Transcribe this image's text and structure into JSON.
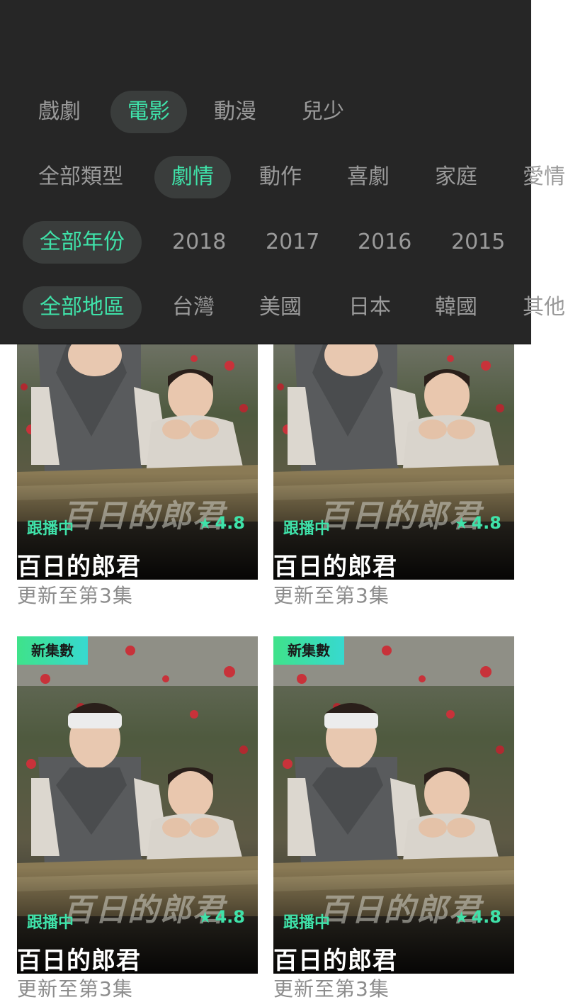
{
  "filters": {
    "categories": [
      {
        "label": "戲劇",
        "active": false
      },
      {
        "label": "電影",
        "active": true
      },
      {
        "label": "動漫",
        "active": false
      },
      {
        "label": "兒少",
        "active": false
      }
    ],
    "genres": [
      {
        "label": "全部類型",
        "active": false
      },
      {
        "label": "劇情",
        "active": true
      },
      {
        "label": "動作",
        "active": false
      },
      {
        "label": "喜劇",
        "active": false
      },
      {
        "label": "家庭",
        "active": false
      },
      {
        "label": "愛情",
        "active": false
      }
    ],
    "years": [
      {
        "label": "全部年份",
        "active": true
      },
      {
        "label": "2018",
        "active": false
      },
      {
        "label": "2017",
        "active": false
      },
      {
        "label": "2016",
        "active": false
      },
      {
        "label": "2015",
        "active": false
      }
    ],
    "regions": [
      {
        "label": "全部地區",
        "active": true
      },
      {
        "label": "台灣",
        "active": false
      },
      {
        "label": "美國",
        "active": false
      },
      {
        "label": "日本",
        "active": false
      },
      {
        "label": "韓國",
        "active": false
      },
      {
        "label": "其他",
        "active": false
      }
    ]
  },
  "cards": [
    {
      "title": "百日的郎君",
      "status": "跟播中",
      "rating": "4.8",
      "subtitle": "更新至第3集",
      "poster_text": "百日的郎君",
      "badge": ""
    },
    {
      "title": "百日的郎君",
      "status": "跟播中",
      "rating": "4.8",
      "subtitle": "更新至第3集",
      "poster_text": "百日的郎君",
      "badge": ""
    },
    {
      "title": "百日的郎君",
      "status": "跟播中",
      "rating": "4.8",
      "subtitle": "更新至第3集",
      "poster_text": "百日的郎君",
      "badge": "新集數"
    },
    {
      "title": "百日的郎君",
      "status": "跟播中",
      "rating": "4.8",
      "subtitle": "更新至第3集",
      "poster_text": "百日的郎君",
      "badge": "新集數"
    }
  ],
  "colors": {
    "accent": "#3fe2a9",
    "panel_bg": "#262626",
    "chip_active_bg": "#3a3d3c",
    "chip_text": "#9a9a9a",
    "subtitle_text": "#8c8c8c"
  },
  "icons": {
    "rating": "star-icon"
  }
}
